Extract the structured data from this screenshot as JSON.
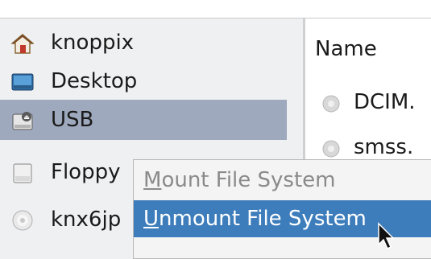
{
  "sidebar": {
    "items": [
      {
        "label": "knoppix",
        "icon": "home-icon"
      },
      {
        "label": "Desktop",
        "icon": "desktop-icon"
      },
      {
        "label": "USB",
        "icon": "usb-drive-icon"
      },
      {
        "label": "Floppy",
        "icon": "floppy-icon"
      },
      {
        "label": "knx6jp",
        "icon": "cdrom-icon"
      }
    ]
  },
  "file_list": {
    "column_name": "Name",
    "rows": [
      {
        "label": "DCIM.",
        "icon": "file-icon"
      },
      {
        "label": "smss.",
        "icon": "file-icon"
      }
    ]
  },
  "context_menu": {
    "items": [
      {
        "label": "Mount File System",
        "mnemonic": "M",
        "rest": "ount File System",
        "enabled": false
      },
      {
        "label": "Unmount File System",
        "mnemonic": "U",
        "rest": "nmount File System",
        "enabled": true,
        "highlighted": true
      }
    ]
  },
  "colors": {
    "selection": "#9fa9bd",
    "menu_highlight": "#3d7dbb",
    "sidebar_bg": "#eef0f2"
  }
}
